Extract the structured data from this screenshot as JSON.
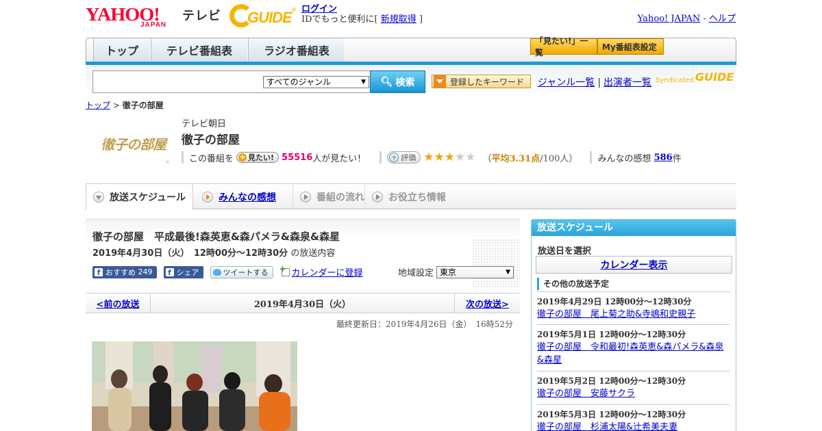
{
  "header": {
    "brand_yahoo": "YAHOO!",
    "brand_japan": "JAPAN",
    "brand_tv": "テレビ",
    "gguide": "GUIDE",
    "login_link": "ログイン",
    "login_text": "IDでもっと便利に[",
    "signup_link": "新規取得",
    "login_close": "]",
    "yahoo_japan_link": "Yahoo! JAPAN",
    "sep": "-",
    "help_link": "ヘルプ"
  },
  "nav": {
    "tabs": [
      "トップ",
      "テレビ番組表",
      "ラジオ番組表"
    ],
    "mitai_list": "「見たい!」一覧",
    "my_schedule": "My番組表設定"
  },
  "search": {
    "placeholder": "",
    "genre_selected": "すべてのジャンル",
    "button_label": "検索",
    "keyword_button": "登録したキーワード",
    "genre_list": "ジャンル一覧",
    "performer_list": "出演者一覧",
    "link_sep": "|",
    "syndicated": "Syndicated",
    "syndicated_g": "GUIDE"
  },
  "breadcrumb": {
    "top": "トップ",
    "sep": ">",
    "current": "徹子の部屋"
  },
  "program": {
    "logo_text": "徹子の部屋",
    "station": "テレビ朝日",
    "title": "徹子の部屋",
    "mitai_prefix": "この番組を",
    "mitai_button": "見たい!",
    "mitai_count": "55516",
    "mitai_suffix": "人が見たい！",
    "eval_button": "評価",
    "rating_stars": 3,
    "rating_max": 5,
    "avg_open": "（",
    "avg_text": "平均3.31点",
    "avg_count": "/100人）",
    "impressions_label": "みんなの感想",
    "impressions_count": "586",
    "impressions_unit": "件"
  },
  "subtabs": [
    "放送スケジュール",
    "みんなの感想",
    "番組の流れ",
    "お役立ち情報"
  ],
  "episode": {
    "title": "徹子の部屋　平成最後!森英恵&森パメラ&森泉&森星",
    "date_time": "2019年4月30日（火）　12時00分～12時30分",
    "date_time_suffix": "の放送内容",
    "fb_recommend": "おすすめ",
    "fb_count": "249",
    "fb_share": "シェア",
    "tweet": "ツイートする",
    "calendar_register": "カレンダーに登録",
    "region_label": "地域設定",
    "region_selected": "東京"
  },
  "pager": {
    "prev": "<前の放送",
    "current": "2019年4月30日（火）",
    "next": "次の放送>"
  },
  "updated": "最終更新日：2019年4月26日（金）　16時52分",
  "side": {
    "title": "放送スケジュール",
    "date_select_label": "放送日を選択",
    "calendar_button": "カレンダー表示",
    "other_label": "その他の放送予定",
    "schedule": [
      {
        "date": "2019年4月29日  12時00分～12時30分",
        "title": "徹子の部屋　尾上菊之助&寺嶋和史親子"
      },
      {
        "date": "2019年5月1日  12時00分～12時30分",
        "title": "徹子の部屋　令和最初!森英恵&森パメラ&森泉&森星"
      },
      {
        "date": "2019年5月2日  12時00分～12時30分",
        "title": "徹子の部屋　安藤サクラ"
      },
      {
        "date": "2019年5月3日  12時00分～12時30分",
        "title": "徹子の部屋　杉浦太陽&辻希美夫妻"
      }
    ]
  },
  "colors": {
    "accent_blue": "#1f9ad6",
    "gguide_yellow": "#f2b600",
    "yahoo_red": "#ff0033",
    "mitai_pink": "#e0006a"
  }
}
